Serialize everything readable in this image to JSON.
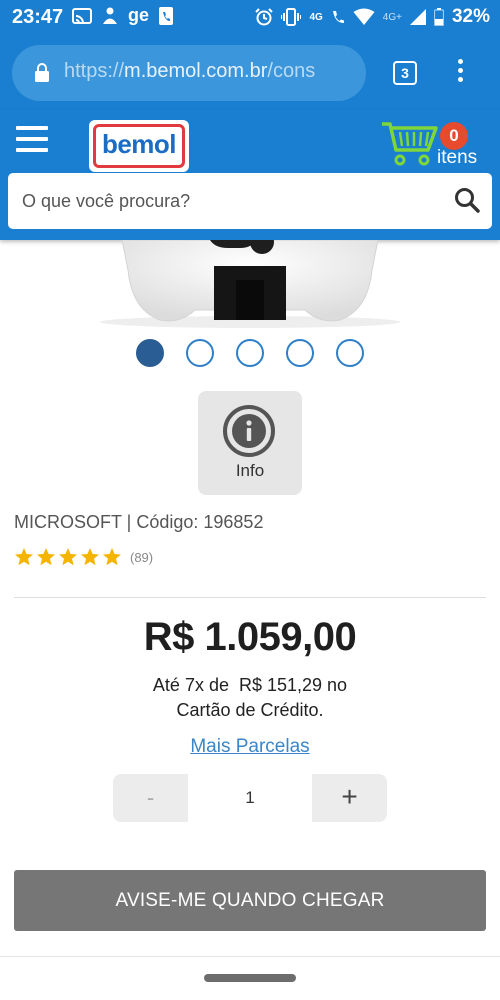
{
  "status_bar": {
    "time": "23:47",
    "left_icons": [
      "cast-icon",
      "person-icon",
      "ge",
      "phone-app-icon"
    ],
    "ge_label": "ge",
    "network_label": "4G",
    "signal_label": "4G+",
    "battery": "32%"
  },
  "browser": {
    "url_scheme": "https://",
    "url_host": "m.bemol.com.br",
    "url_path": "/cons",
    "tab_count": "3"
  },
  "header": {
    "logo_text": "bemol",
    "cart_count": "0",
    "cart_label": "itens",
    "search_placeholder": "O que você procura?"
  },
  "carousel": {
    "slide_count": 5,
    "active_index": 0
  },
  "info_button": {
    "label": "Info"
  },
  "product": {
    "brand_line": "MICROSOFT | Código: 196852",
    "rating_stars": 5,
    "review_count": "(89)",
    "price": "R$ 1.059,00",
    "installments_line1": "Até 7x de  R$ 151,29 no",
    "installments_line2": "Cartão de Crédito.",
    "more_installments_link": "Mais Parcelas"
  },
  "quantity": {
    "minus_label": "-",
    "value": "1",
    "plus_label": "+"
  },
  "notify_button": {
    "label": "AVISE-ME QUANDO CHEGAR"
  },
  "colors": {
    "brand_blue": "#1a7fd0",
    "logo_red": "#e03a3e",
    "badge_red": "#e84a2e",
    "star_gold": "#f5b400",
    "link_blue": "#3a86c8",
    "dot_active": "#2a5d93",
    "notify_gray": "#767676"
  }
}
